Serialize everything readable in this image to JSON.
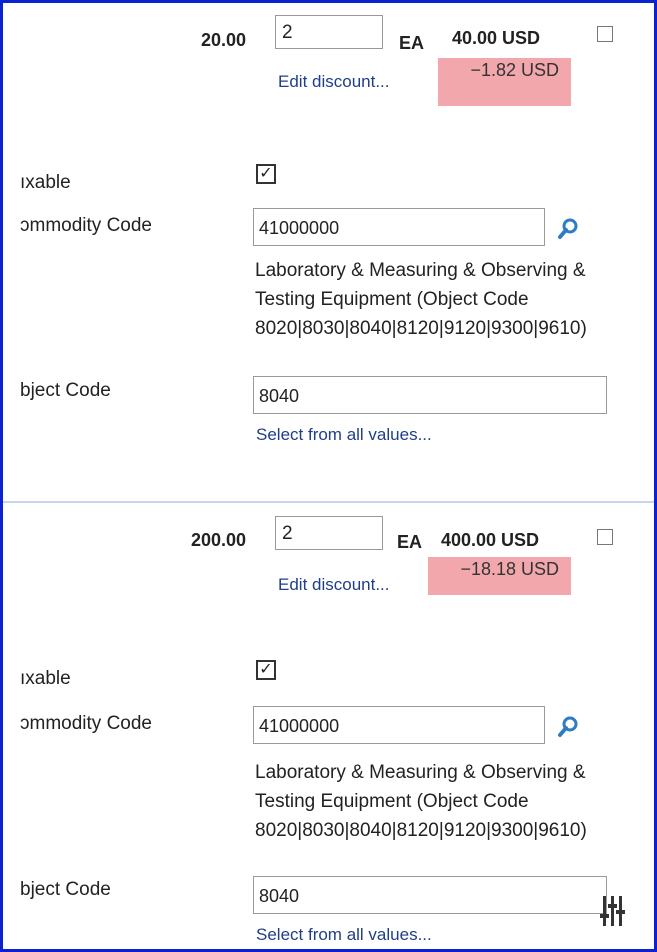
{
  "items": [
    {
      "unit_price": "20.00",
      "quantity": "2",
      "uom": "EA",
      "total": "40.00 USD",
      "discount": "−1.82 USD",
      "edit_discount_label": "Edit discount...",
      "taxable_label": "ıxable",
      "commodity_label": "ɔmmodity Code",
      "commodity_value": "41000000",
      "commodity_desc": "Laboratory & Measuring & Observing & Testing Equipment (Object Code 8020|8030|8040|8120|9120|9300|9610)",
      "object_label": "bject Code",
      "object_value": "8040",
      "select_all_label": "Select from all values..."
    },
    {
      "unit_price": "200.00",
      "quantity": "2",
      "uom": "EA",
      "total": "400.00 USD",
      "discount": "−18.18 USD",
      "edit_discount_label": "Edit discount...",
      "taxable_label": "ıxable",
      "commodity_label": "ɔmmodity Code",
      "commodity_value": "41000000",
      "commodity_desc": "Laboratory & Measuring & Observing & Testing Equipment (Object Code 8020|8030|8040|8120|9120|9300|9610)",
      "object_label": "bject Code",
      "object_value": "8040",
      "select_all_label": "Select from all values..."
    }
  ],
  "colors": {
    "frame_border": "#0a22d0",
    "discount_bg": "#f2a7ad",
    "link": "#1f3f86",
    "search_icon": "#2e7cc4"
  },
  "icons": [
    "search-icon",
    "column-settings-icon",
    "checkbox-checked-icon",
    "checkbox-empty-icon"
  ]
}
